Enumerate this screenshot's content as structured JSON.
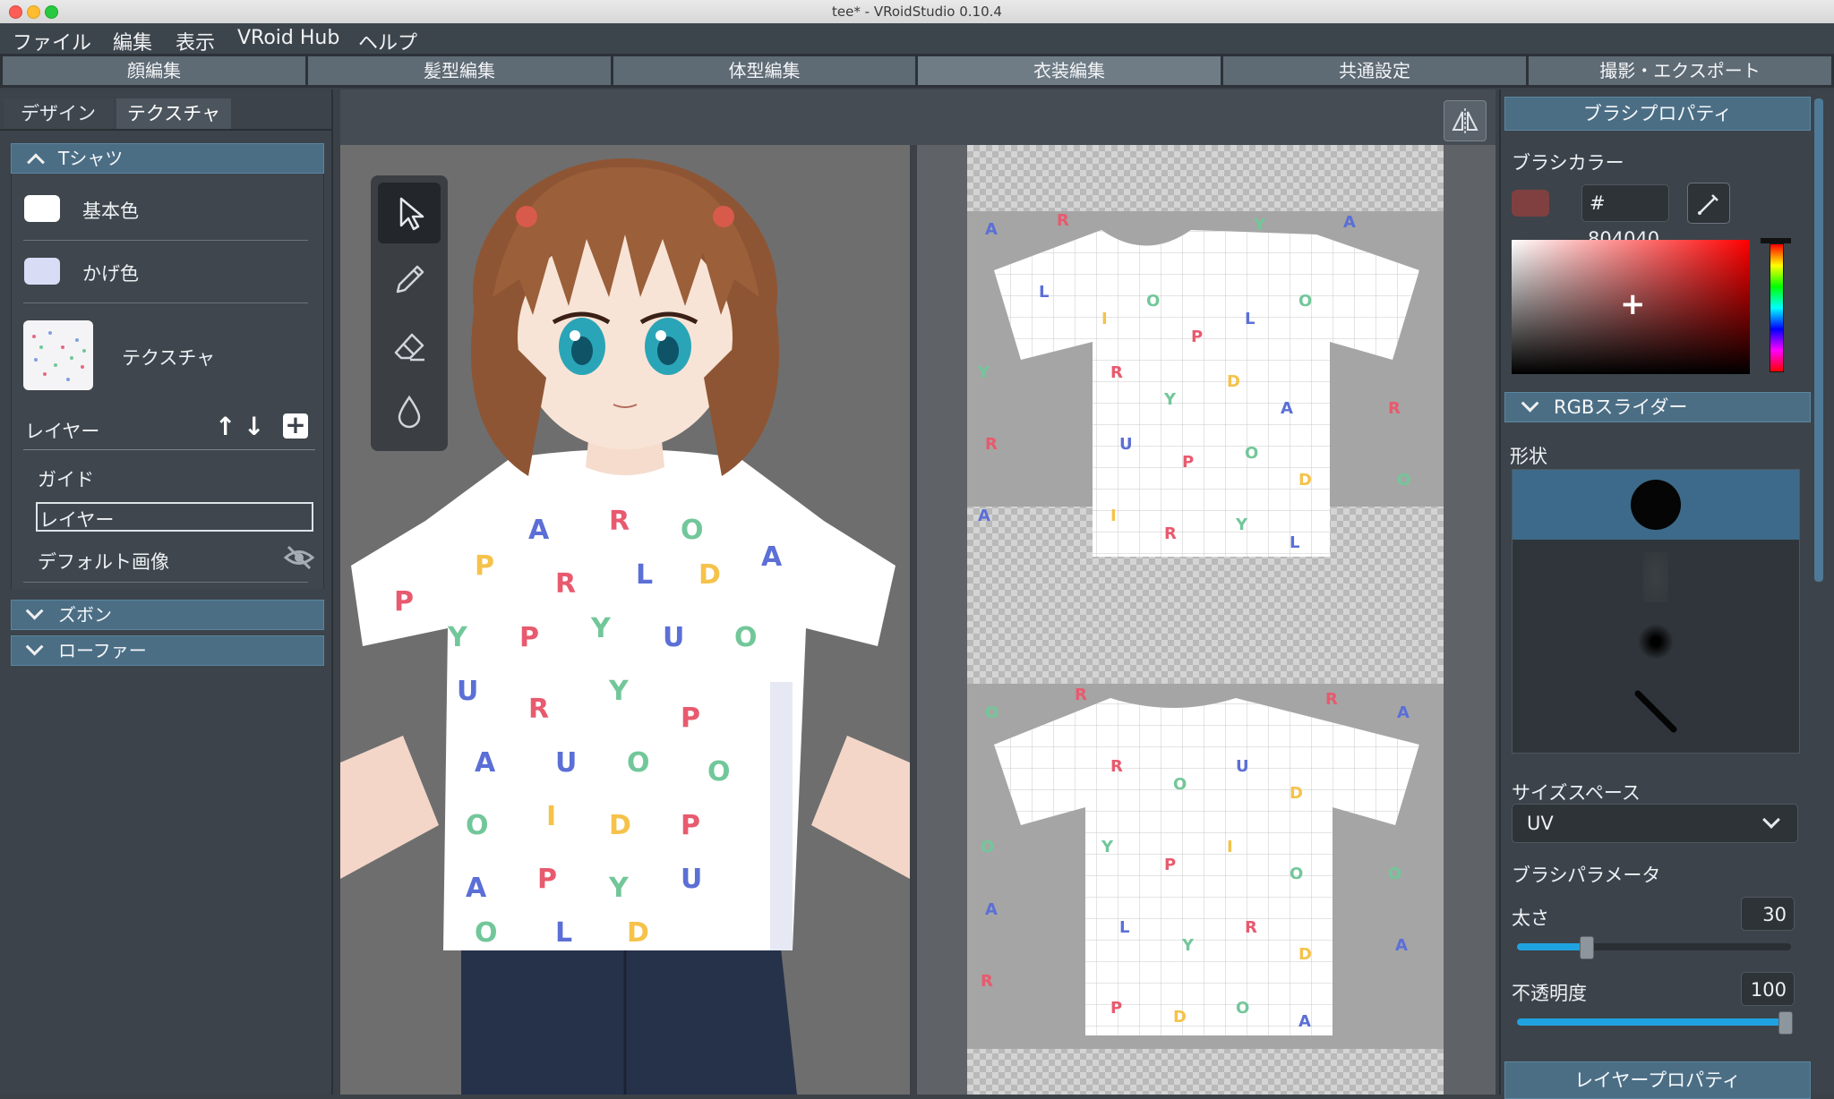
{
  "window": {
    "title": "tee* - VRoidStudio 0.10.4"
  },
  "menu": [
    "ファイル",
    "編集",
    "表示",
    "VRoid Hub",
    "ヘルプ"
  ],
  "main_tabs": [
    "顔編集",
    "髪型編集",
    "体型編集",
    "衣装編集",
    "共通設定",
    "撮影・エクスポート"
  ],
  "active_main_tab": "衣装編集",
  "left": {
    "subtabs": [
      "デザイン",
      "テクスチャ"
    ],
    "active_subtab": "テクスチャ",
    "tshirt_section": "Tシャツ",
    "base_color_label": "基本色",
    "shade_color_label": "かげ色",
    "texture_label": "テクスチャ",
    "layer_label": "レイヤー",
    "layers": [
      "ガイド",
      "レイヤー",
      "デフォルト画像"
    ],
    "pants_section": "ズボン",
    "loafer_section": "ローファー"
  },
  "colors": {
    "base_color": "#ffffff",
    "shade_color": "#d9dcf5",
    "brush_color": "#804040",
    "accent": "#1fa3e0"
  },
  "right": {
    "brush_properties_title": "ブラシプロパティ",
    "brush_color_label": "ブラシカラー",
    "hash": "#",
    "brush_color_hex": "804040",
    "rgb_slider_label": "RGBスライダー",
    "shape_label": "形状",
    "size_space_label": "サイズスペース",
    "size_space_value": "UV",
    "brush_params_label": "ブラシパラメータ",
    "thickness_label": "太さ",
    "thickness_value": "30",
    "thickness_fraction": 0.25,
    "opacity_label": "不透明度",
    "opacity_value": "100",
    "opacity_fraction": 1.0,
    "layer_properties_title": "レイヤープロパティ"
  },
  "icons": {
    "tools": [
      "select-arrow-icon",
      "pencil-icon",
      "eraser-icon",
      "fill-drop-icon"
    ],
    "mirror": "mirror-icon",
    "eyedropper": "eyedropper-icon",
    "hide_layer": "eye-slash-icon"
  }
}
